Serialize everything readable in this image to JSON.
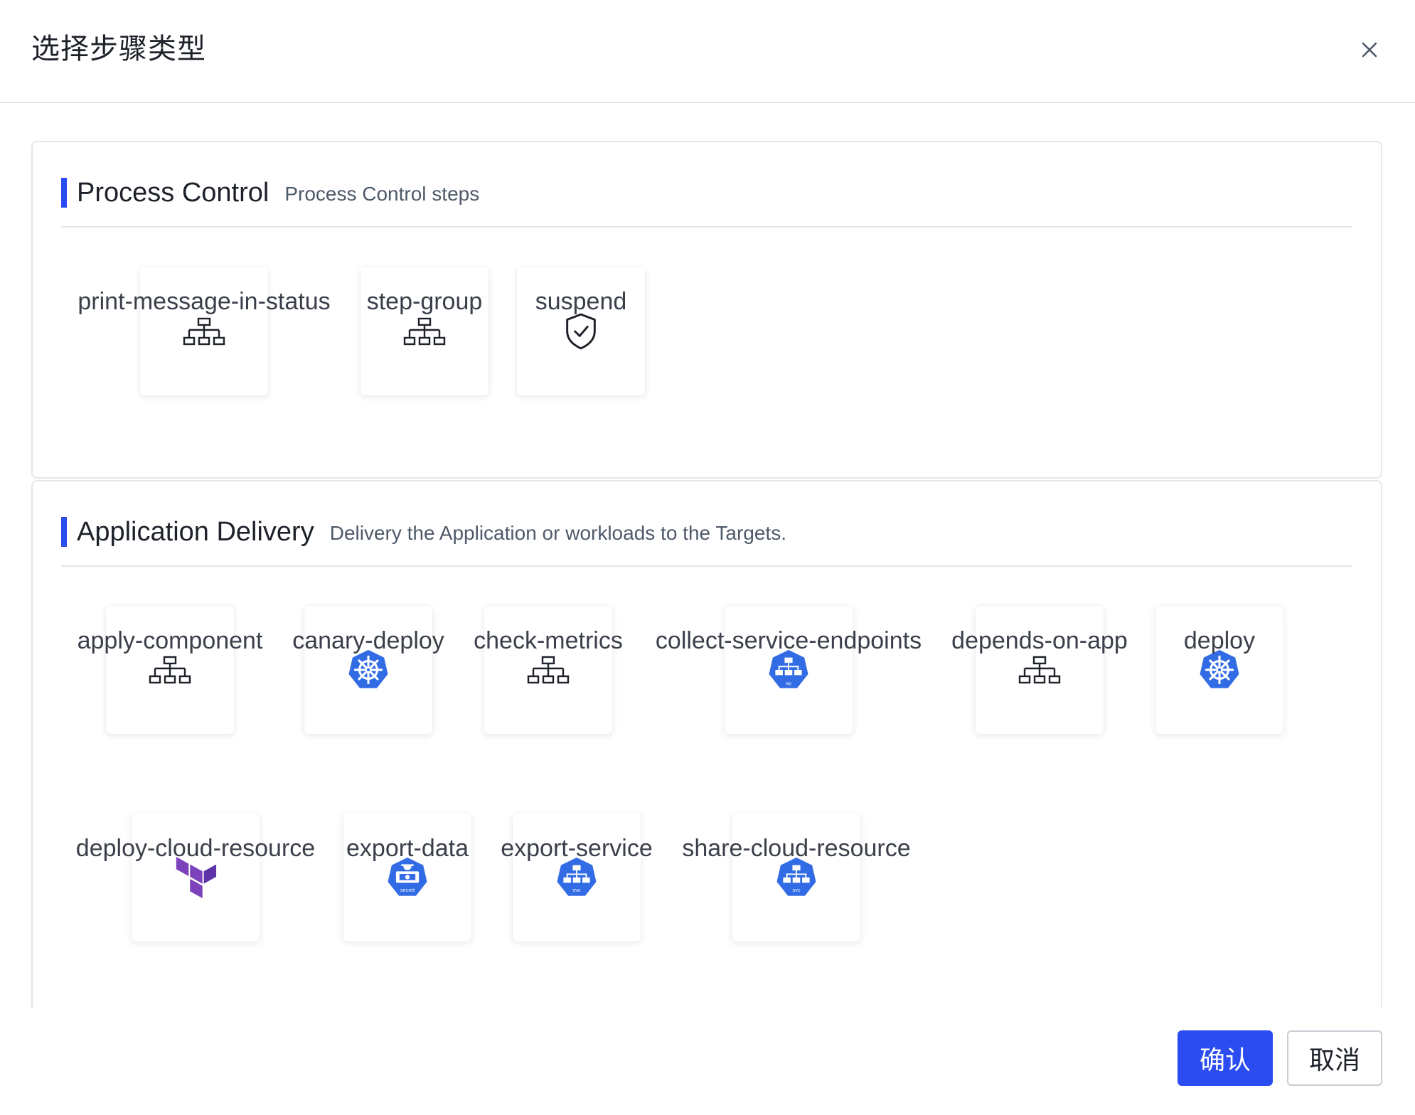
{
  "dialog": {
    "title": "选择步骤类型",
    "close_icon": "close-icon"
  },
  "sections": [
    {
      "title": "Process Control",
      "description": "Process Control steps",
      "items": [
        {
          "label": "print-message-in-status",
          "icon": "hierarchy-icon"
        },
        {
          "label": "step-group",
          "icon": "hierarchy-icon"
        },
        {
          "label": "suspend",
          "icon": "shield-check-icon"
        }
      ]
    },
    {
      "title": "Application Delivery",
      "description": "Delivery the Application or workloads to the Targets.",
      "items": [
        {
          "label": "apply-component",
          "icon": "hierarchy-icon"
        },
        {
          "label": "canary-deploy",
          "icon": "kubernetes-icon"
        },
        {
          "label": "check-metrics",
          "icon": "hierarchy-icon"
        },
        {
          "label": "collect-service-endpoints",
          "icon": "kubernetes-ep-icon",
          "badge": "ep"
        },
        {
          "label": "depends-on-app",
          "icon": "hierarchy-icon"
        },
        {
          "label": "deploy",
          "icon": "kubernetes-icon"
        },
        {
          "label": "deploy-cloud-resource",
          "icon": "terraform-icon"
        },
        {
          "label": "export-data",
          "icon": "kubernetes-secret-icon",
          "badge": "secret"
        },
        {
          "label": "export-service",
          "icon": "kubernetes-svc-icon",
          "badge": "svc"
        },
        {
          "label": "share-cloud-resource",
          "icon": "kubernetes-svc-icon",
          "badge": "svc"
        }
      ]
    }
  ],
  "footer": {
    "confirm_label": "确认",
    "cancel_label": "取消"
  },
  "colors": {
    "primary": "#2a4cf0",
    "kubernetes": "#326ce5",
    "terraform": "#7b42bc",
    "border": "#e5e6eb"
  }
}
